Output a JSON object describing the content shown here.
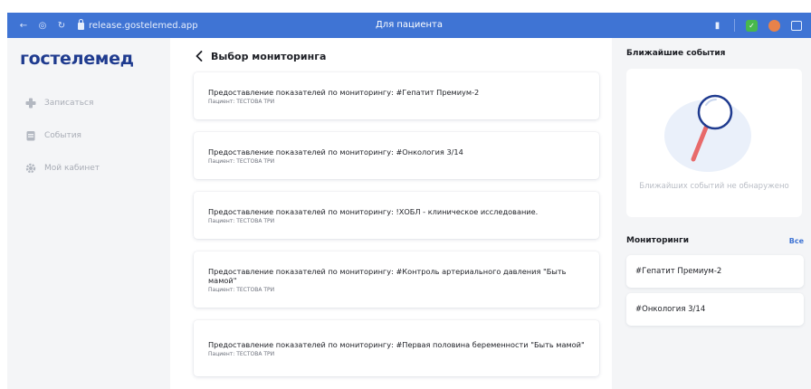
{
  "browser": {
    "url": "release.gostelemed.app",
    "tab_title": "Для пациента"
  },
  "sidebar": {
    "logo": "гостелемед",
    "items": [
      {
        "label": "Записаться",
        "icon": "plus-icon"
      },
      {
        "label": "События",
        "icon": "calendar-icon"
      },
      {
        "label": "Мой кабинет",
        "icon": "gear-icon"
      }
    ]
  },
  "main": {
    "title": "Выбор мониторинга",
    "cards": [
      {
        "title": "Предоставление показателей по мониторингу: #Гепатит Премиум-2",
        "patient": "Пациент: ТЕСТОВА ТРИ"
      },
      {
        "title": "Предоставление показателей по мониторингу: #Онкология 3/14",
        "patient": "Пациент: ТЕСТОВА ТРИ"
      },
      {
        "title": "Предоставление показателей по мониторингу: !ХОБЛ - клиническое исследование.",
        "patient": "Пациент: ТЕСТОВА ТРИ"
      },
      {
        "title": "Предоставление показателей по мониторингу: #Контроль артериального давления \"Быть мамой\"",
        "patient": "Пациент: ТЕСТОВА ТРИ"
      },
      {
        "title": "Предоставление показателей по мониторингу: #Первая половина беременности \"Быть мамой\"",
        "patient": "Пациент: ТЕСТОВА ТРИ"
      }
    ]
  },
  "right": {
    "events_title": "Ближайшие события",
    "empty_text": "Ближайших событий не обнаружено",
    "monitorings_title": "Мониторинги",
    "all_link": "Все",
    "monitorings": [
      {
        "label": "#Гепатит Премиум-2"
      },
      {
        "label": "#Онкология 3/14"
      }
    ]
  },
  "colors": {
    "browser_bar": "#3f74d4",
    "logo": "#1f3b8f",
    "link": "#3f74d4",
    "panel_bg": "#f4f5f7"
  }
}
